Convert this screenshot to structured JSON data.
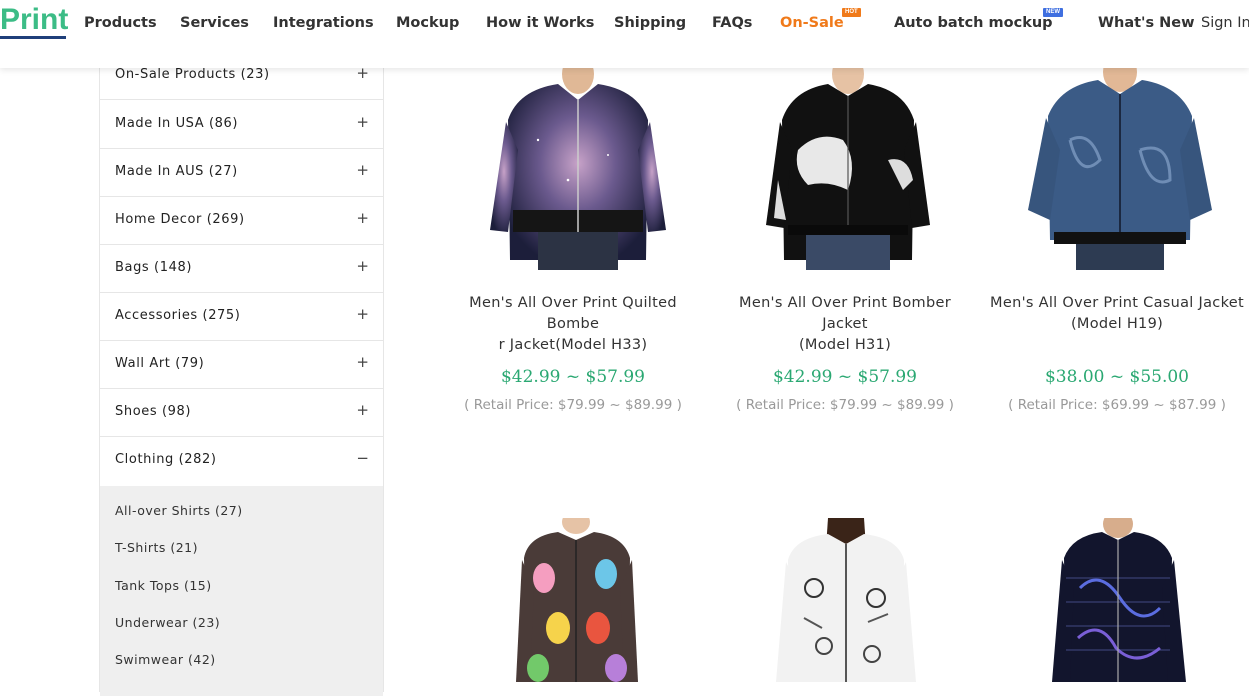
{
  "brand": {
    "logo_text": "Print"
  },
  "nav": {
    "items": [
      {
        "label": "Products"
      },
      {
        "label": "Services"
      },
      {
        "label": "Integrations"
      },
      {
        "label": "Mockup"
      },
      {
        "label": "How it Works"
      },
      {
        "label": "Shipping"
      },
      {
        "label": "FAQs"
      },
      {
        "label": "On-Sale",
        "badge": "HOT"
      },
      {
        "label": "Auto batch mockup",
        "badge": "NEW"
      },
      {
        "label": "What's New"
      }
    ],
    "signin": "Sign In"
  },
  "colors": {
    "accent_green": "#2aa872",
    "sale_orange": "#f07a1a",
    "logo_green": "#3cbc86"
  },
  "sidebar": {
    "categories": [
      {
        "label": "On-Sale Products  (23)",
        "toggle": "+"
      },
      {
        "label": "Made In USA  (86)",
        "toggle": "+"
      },
      {
        "label": "Made In AUS  (27)",
        "toggle": "+"
      },
      {
        "label": "Home Decor  (269)",
        "toggle": "+"
      },
      {
        "label": "Bags  (148)",
        "toggle": "+"
      },
      {
        "label": "Accessories  (275)",
        "toggle": "+"
      },
      {
        "label": "Wall Art  (79)",
        "toggle": "+"
      },
      {
        "label": "Shoes  (98)",
        "toggle": "+"
      },
      {
        "label": "Clothing  (282)",
        "toggle": "−"
      }
    ],
    "subcategories": [
      {
        "label": "All-over Shirts  (27)"
      },
      {
        "label": "T-Shirts  (21)"
      },
      {
        "label": "Tank Tops  (15)"
      },
      {
        "label": "Underwear  (23)"
      },
      {
        "label": "Swimwear  (42)"
      }
    ]
  },
  "products": [
    {
      "title_line1": "Men's All Over Print Quilted Bombe",
      "title_line2": "r Jacket(Model H33)",
      "price": "$42.99 ~ $57.99",
      "retail": "( Retail Price: $79.99 ~ $89.99 )",
      "image_icon": "galaxy-bomber-jacket-photo"
    },
    {
      "title_line1": "Men's All Over Print Bomber Jacket",
      "title_line2": "(Model H31)",
      "price": "$42.99 ~ $57.99",
      "retail": "( Retail Price: $79.99 ~ $89.99 )",
      "image_icon": "bear-bomber-jacket-photo"
    },
    {
      "title_line1": "Men's All Over Print Casual Jacket",
      "title_line2": "(Model H19)",
      "price": "$38.00 ~ $55.00",
      "retail": "( Retail Price: $69.99 ~ $87.99 )",
      "image_icon": "blue-casual-jacket-photo"
    },
    {
      "image_icon": "easter-egg-jacket-photo"
    },
    {
      "image_icon": "skull-pattern-jacket-photo"
    },
    {
      "image_icon": "galaxy-puffer-jacket-photo"
    }
  ]
}
